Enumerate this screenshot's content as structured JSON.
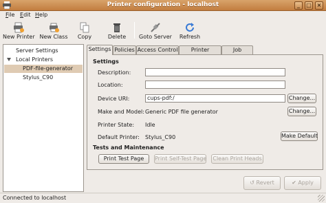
{
  "window": {
    "title": "Printer configuration - localhost"
  },
  "menu": [
    {
      "label": "File",
      "mnemonic": "F",
      "rest": "ile"
    },
    {
      "label": "Edit",
      "mnemonic": "E",
      "rest": "dit"
    },
    {
      "label": "Help",
      "mnemonic": "H",
      "rest": "elp"
    }
  ],
  "toolbar": {
    "new_printer": "New Printer",
    "new_class": "New Class",
    "copy": "Copy",
    "delete": "Delete",
    "goto_server": "Goto Server",
    "refresh": "Refresh"
  },
  "tree": {
    "server_settings": "Server Settings",
    "local_printers": "Local Printers",
    "printers": [
      "PDF-file-generator",
      "Stylus_C90"
    ]
  },
  "tabs": [
    "Settings",
    "Policies",
    "Access Control",
    "Printer Options",
    "Job Options"
  ],
  "settings": {
    "section_title": "Settings",
    "description_label": "Description:",
    "description_value": "",
    "location_label": "Location:",
    "location_value": "",
    "device_uri_label": "Device URI:",
    "device_uri_value": "cups-pdf:/",
    "change_label": "Change...",
    "make_model_label": "Make and Model:",
    "make_model_value": "Generic PDF file generator",
    "state_label": "Printer State:",
    "state_value": "Idle",
    "default_label": "Default Printer:",
    "default_value": "Stylus_C90",
    "make_default": "Make Default"
  },
  "tests": {
    "section_title": "Tests and Maintenance",
    "print_test_page": "Print Test Page",
    "print_self_test": "Print Self-Test Page",
    "clean_heads": "Clean Print Heads"
  },
  "footer": {
    "revert": "Revert",
    "apply": "Apply"
  },
  "status": {
    "text": "Connected to localhost"
  },
  "colors": {
    "titlebar": "#c98a4e",
    "selection": "#dfcbb3",
    "background": "#efebe7"
  }
}
